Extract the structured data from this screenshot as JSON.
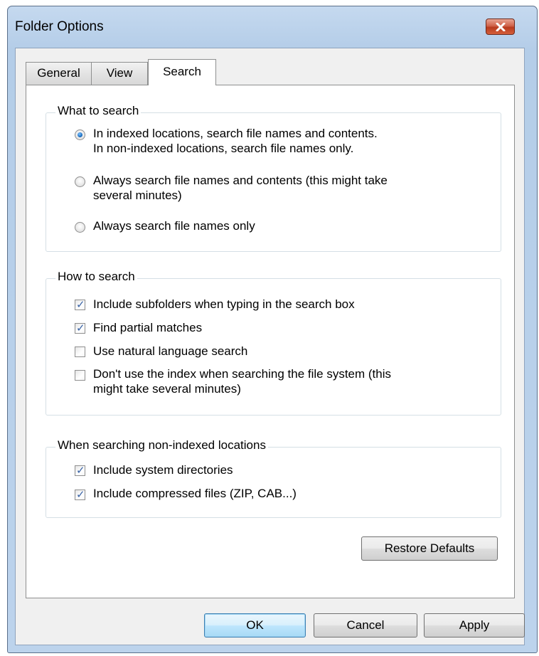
{
  "window": {
    "title": "Folder Options"
  },
  "tabs": [
    {
      "label": "General"
    },
    {
      "label": "View"
    },
    {
      "label": "Search",
      "active": true
    }
  ],
  "what_to_search": {
    "legend": "What to search",
    "options": [
      {
        "line1": "In indexed locations, search file names and contents.",
        "line2": "In non-indexed locations, search file names only.",
        "checked": true
      },
      {
        "line1": "Always search file names and contents (this might take",
        "line2": "several minutes)",
        "checked": false
      },
      {
        "line1": "Always search file names only",
        "checked": false
      }
    ]
  },
  "how_to_search": {
    "legend": "How to search",
    "options": [
      {
        "line1": "Include subfolders when typing in the search box",
        "checked": true
      },
      {
        "line1": "Find partial matches",
        "checked": true
      },
      {
        "line1": "Use natural language search",
        "checked": false
      },
      {
        "line1": "Don't use the index when searching the file system (this",
        "line2": "might take several minutes)",
        "checked": false
      }
    ]
  },
  "non_indexed": {
    "legend": "When searching non-indexed locations",
    "options": [
      {
        "line1": "Include system directories",
        "checked": true
      },
      {
        "line1": "Include compressed files (ZIP, CAB...)",
        "checked": true
      }
    ]
  },
  "buttons": {
    "restore_defaults": "Restore Defaults",
    "ok": "OK",
    "cancel": "Cancel",
    "apply": "Apply"
  },
  "icons": {
    "close": "close-icon",
    "check": "checkmark-icon"
  }
}
